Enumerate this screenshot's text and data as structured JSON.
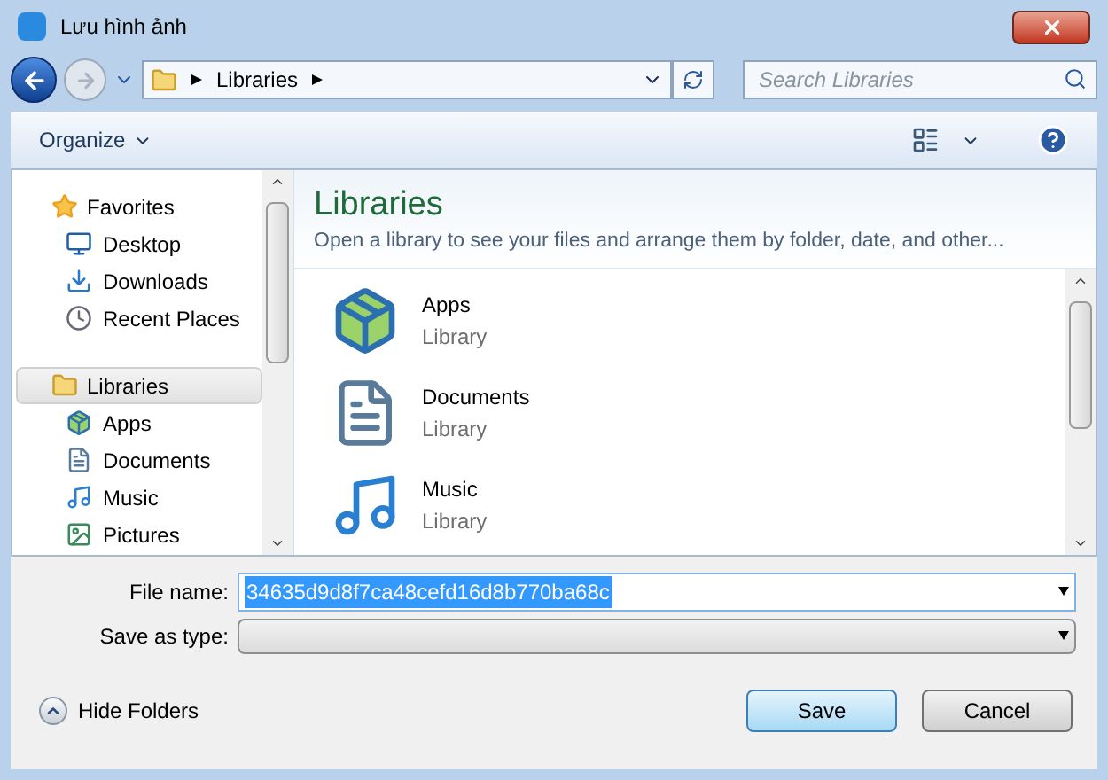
{
  "window": {
    "title": "Lưu hình ảnh"
  },
  "address_bar": {
    "path": [
      "Libraries"
    ],
    "search_placeholder": "Search Libraries"
  },
  "toolbar": {
    "organize": "Organize"
  },
  "nav_pane": [
    {
      "label": "Favorites",
      "kind": "star",
      "selected": false,
      "children": [
        {
          "label": "Desktop",
          "kind": "desktop",
          "selected": false
        },
        {
          "label": "Downloads",
          "kind": "downloads",
          "selected": false
        },
        {
          "label": "Recent Places",
          "kind": "recent",
          "selected": false
        }
      ]
    },
    {
      "label": "Libraries",
      "kind": "library",
      "selected": true,
      "children": [
        {
          "label": "Apps",
          "kind": "apps",
          "selected": false
        },
        {
          "label": "Documents",
          "kind": "documents",
          "selected": false
        },
        {
          "label": "Music",
          "kind": "music",
          "selected": false
        },
        {
          "label": "Pictures",
          "kind": "pictures",
          "selected": false
        }
      ]
    }
  ],
  "content": {
    "title": "Libraries",
    "subtitle": "Open a library to see your files and arrange them by folder, date, and other...",
    "items": [
      {
        "name": "Apps",
        "type": "Library",
        "kind": "apps"
      },
      {
        "name": "Documents",
        "type": "Library",
        "kind": "documents"
      },
      {
        "name": "Music",
        "type": "Library",
        "kind": "music"
      }
    ]
  },
  "form": {
    "file_name_label": "File name:",
    "file_name": "34635d9d8f7ca48cefd16d8b770ba68c",
    "save_type_label": "Save as type:"
  },
  "footer": {
    "hide_folders": "Hide Folders",
    "save": "Save",
    "cancel": "Cancel"
  }
}
